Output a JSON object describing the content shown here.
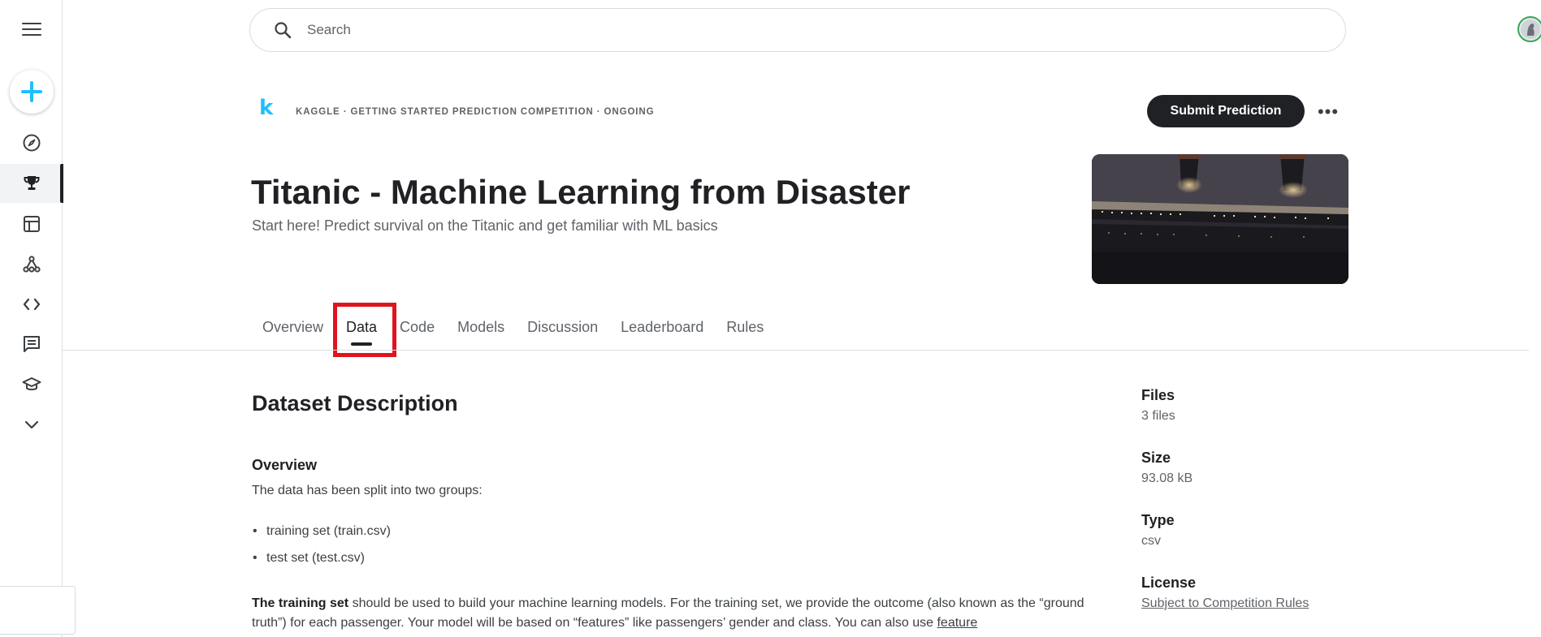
{
  "search": {
    "placeholder": "Search"
  },
  "header": {
    "breadcrumb": "KAGGLE · GETTING STARTED PREDICTION COMPETITION · ONGOING",
    "submit_label": "Submit Prediction",
    "more_label": "•••",
    "title": "Titanic - Machine Learning from Disaster",
    "subtitle": "Start here! Predict survival on the Titanic and get familiar with ML basics"
  },
  "tabs": [
    {
      "label": "Overview"
    },
    {
      "label": "Data"
    },
    {
      "label": "Code"
    },
    {
      "label": "Models"
    },
    {
      "label": "Discussion"
    },
    {
      "label": "Leaderboard"
    },
    {
      "label": "Rules"
    }
  ],
  "content": {
    "heading": "Dataset Description",
    "overview_heading": "Overview",
    "intro": "The data has been split into two groups:",
    "bullets": [
      "training set (train.csv)",
      "test set (test.csv)"
    ],
    "training_bold": "The training set",
    "training_text": " should be used to build your machine learning models. For the training set, we provide the outcome (also known as the “ground truth”) for each passenger. Your model will be based on “features” like passengers’ gender and class. You can also use ",
    "feature_link": "feature"
  },
  "meta": {
    "files_label": "Files",
    "files_value": "3 files",
    "size_label": "Size",
    "size_value": "93.08 kB",
    "type_label": "Type",
    "type_value": "csv",
    "license_label": "License",
    "license_value": "Subject to Competition Rules"
  },
  "colors": {
    "kaggle_blue": "#20beff",
    "highlight_red": "#e0141e",
    "dark": "#202124"
  },
  "icons": {
    "menu": "menu-icon",
    "create": "plus-icon",
    "nav": [
      "compass-icon",
      "trophy-icon",
      "table-icon",
      "models-icon",
      "code-icon",
      "discussion-icon",
      "learn-icon",
      "chevron-down-icon"
    ],
    "search": "search-icon"
  }
}
